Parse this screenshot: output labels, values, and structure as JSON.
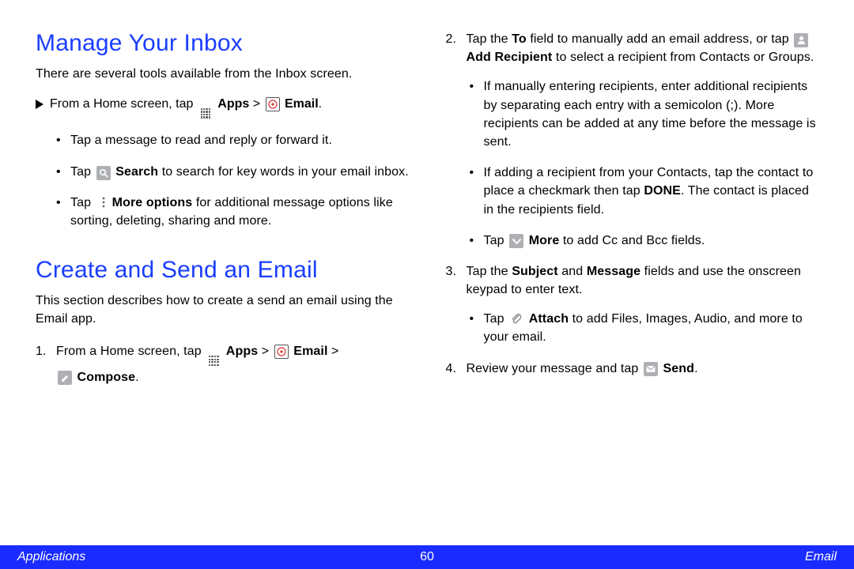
{
  "left": {
    "h1": "Manage Your Inbox",
    "intro1": "There are several tools available from the Inbox screen.",
    "from_prefix": "From a Home screen, tap ",
    "apps_label": "Apps",
    "gt": " > ",
    "email_label": "Email",
    "period": ".",
    "b1": "Tap a message to read and reply or forward it.",
    "b2a": "Tap ",
    "b2b": "Search",
    "b2c": " to search for key words in your email inbox.",
    "b3a": "Tap ",
    "b3b": "More options",
    "b3c": " for additional message options like sorting, deleting, sharing and more.",
    "h2": "Create and Send an Email",
    "intro2": "This section describes how to create a send an email using the Email app.",
    "s1_prefix": "From a Home screen, tap ",
    "compose_label": "Compose"
  },
  "right": {
    "s2a": "Tap the ",
    "s2b": "To",
    "s2c": " field to manually add an email address, or tap ",
    "s2d": "Add Recipient",
    "s2e": " to select a recipient from Contacts or Groups.",
    "s2_b1": "If manually entering recipients, enter additional recipients by separating each entry with a semicolon (;). More recipients can be added at any time before the message is sent.",
    "s2_b2a": "If adding a recipient from your Contacts, tap the contact to place a checkmark then tap ",
    "s2_b2b": "DONE",
    "s2_b2c": ". The contact is placed in the recipients field.",
    "s2_b3a": "Tap ",
    "s2_b3b": "More",
    "s2_b3c": " to add Cc and Bcc fields.",
    "s3a": "Tap the ",
    "s3b": "Subject",
    "s3c": " and ",
    "s3d": "Message",
    "s3e": " fields and use the onscreen keypad to enter text.",
    "s3_b1a": "Tap ",
    "s3_b1b": "Attach",
    "s3_b1c": " to add Files, Images, Audio, and more to your email.",
    "s4a": "Review your message and tap ",
    "s4b": "Send",
    "s4c": "."
  },
  "footer": {
    "left": "Applications",
    "center": "60",
    "right": "Email"
  }
}
